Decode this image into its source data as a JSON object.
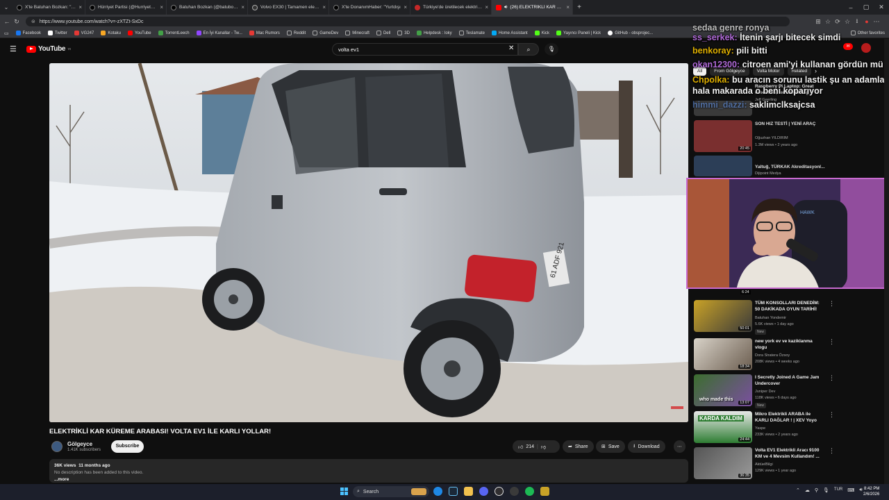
{
  "browser": {
    "tabs": [
      {
        "label": "X'te Batuhan Bozkan: \"Paypal, Ap",
        "color": "#000000"
      },
      {
        "label": "Hürriyet Partisi (@HurriyetPartiIl)",
        "color": "#000000"
      },
      {
        "label": "Batuhan Bozkan (@batubozkan) /",
        "color": "#000000"
      },
      {
        "label": "Volvo EX30 | Tamamen elektrikli k",
        "color": "#222222"
      },
      {
        "label": "X'te DonanımHaber: \"Yurtdışı",
        "color": "#000000"
      },
      {
        "label": "Türkiye'de üretilecek elektrikli Hy",
        "color": "#c62828"
      },
      {
        "label": "(26) ELEKTRİKLİ KAR KÜREM",
        "color": "#ff0000",
        "active": true
      }
    ],
    "url": "https://www.youtube.com/watch?v=-zXTZt-SxDc",
    "bookmarks": [
      {
        "label": "Facebook",
        "color": "#1877f2"
      },
      {
        "label": "Twitter",
        "color": "#ffffff"
      },
      {
        "label": "VG247",
        "color": "#e53935"
      },
      {
        "label": "Kotaku",
        "color": "#f9a825"
      },
      {
        "label": "YouTube",
        "color": "#ff0000"
      },
      {
        "label": "TorrentLeech",
        "color": "#43a047"
      },
      {
        "label": "En İyi Kanallar - Tw...",
        "color": "#9146ff"
      },
      {
        "label": "Mac Rumors",
        "color": "#e53935"
      },
      {
        "label": "Reddit",
        "color": "#aaaaaa"
      },
      {
        "label": "GameDev",
        "color": "#aaaaaa"
      },
      {
        "label": "Minecraft",
        "color": "#aaaaaa"
      },
      {
        "label": "Dell",
        "color": "#aaaaaa"
      },
      {
        "label": "3D",
        "color": "#aaaaaa"
      },
      {
        "label": "Helpdesk : loky",
        "color": "#43a047"
      },
      {
        "label": "Teslamate",
        "color": "#aaaaaa"
      },
      {
        "label": "Home Assistant",
        "color": "#03a9f4"
      },
      {
        "label": "Kick",
        "color": "#53fc18"
      },
      {
        "label": "Yayıncı Paneli | Kick",
        "color": "#53fc18"
      },
      {
        "label": "GitHub - obsprojec...",
        "color": "#ffffff"
      },
      {
        "label": "Other favorites",
        "color": "#aaaaaa"
      }
    ]
  },
  "youtube": {
    "logo": "YouTube",
    "country": "TR",
    "search_value": "volta ev1",
    "video": {
      "title": "ELEKTRİKLİ KAR KÜREME ARABASI! VOLTA EV1 İLE KARLI YOLLAR!",
      "channel": "Gölgeyce",
      "subscribers": "1.41K subscribers",
      "subscribe_label": "Subscribe",
      "likes": "214",
      "share_label": "Share",
      "save_label": "Save",
      "download_label": "Download",
      "views": "36K views",
      "age": "11 months ago",
      "description": "No description has been added to this video.",
      "more_label": "...more",
      "plate": "61 ADF 921"
    },
    "chips": [
      "All",
      "From Gölgeyce",
      "Volta Motor",
      "Related"
    ],
    "recommendations_top": [
      {
        "title": "Raspberry Pi Laptop: Great execution, terrible timing",
        "channel": "Jeff Geerling"
      },
      {
        "title": "SON HIZ TESTİ | YENİ ARAÇ",
        "channel": "Oğuzhan YILDIRIM",
        "meta": "1.3M views • 2 years ago",
        "duration": "20:45"
      },
      {
        "title": "Yaltuğ, TÜRKAK Akreditasyonl...",
        "channel": "Dijipoint Medya"
      }
    ],
    "recommendations": [
      {
        "title": "TÜM KONSOLLARI DENEDİM: 50 DAKİKADA OYUN TARİHİ!",
        "channel": "Batuhan Yondemir",
        "meta": "5.6K views • 1 day ago",
        "badge": "New",
        "duration": "50:01",
        "color1": "#c9a227",
        "color2": "#3a3a3a"
      },
      {
        "title": "new york ev ve kaziklanma vlogu",
        "channel": "Dora Stratera Özsoy",
        "meta": "208K views • 4 weeks ago",
        "duration": "18:34",
        "color1": "#d8d2c8",
        "color2": "#6b5d4f"
      },
      {
        "title": "I Secretly Joined A Game Jam Undercover",
        "channel": "Juniper Dev",
        "meta": "118K views • 6 days ago",
        "badge": "New",
        "duration": "13:07",
        "overlay": "who made this",
        "color1": "#3b6e2e",
        "color2": "#7b4fa0"
      },
      {
        "title": "Mikro Elektrikli ARABA ile KARLI DAĞLAR ! | XEV Yoyo",
        "channel": "Yaspe",
        "meta": "233K views • 2 years ago",
        "duration": "24:44",
        "overlay": "KARDA KALDIM",
        "color1": "#e8e8e8",
        "color2": "#2e7d32"
      },
      {
        "title": "Volta EV1 Elektrikli Aracı 9100 KM ve 4 Mevsim Kullandım! ...",
        "channel": "AktüelBilgi",
        "meta": "129K views • 1 year ago",
        "duration": "36:35",
        "color1": "#555555",
        "color2": "#999999"
      }
    ]
  },
  "chat": [
    {
      "user": "sedaa genre ronya",
      "text": "",
      "color": "#bdbdbd"
    },
    {
      "user": "ss_serkek:",
      "text": "İtenin şarjı bitecek simdi",
      "color": "#b06ad8"
    },
    {
      "user": "benkoray:",
      "text": "pili bitti",
      "color": "#e0b000"
    },
    {
      "user": "okan12300:",
      "text": "citroen ami'yi kullanan gördün mü",
      "color": "#b06ad8"
    },
    {
      "user": "Chpolka:",
      "text": "bu aracın sorunu lastik şu an adamlar hala makarada o beni koparıyor",
      "color": "#e0b000"
    },
    {
      "user": "himmi_dazzi:",
      "text": "saklimclksajcsa",
      "color": "#5e8ee0"
    }
  ],
  "webcam_text": "HAWK",
  "taskbar": {
    "search_label": "Search",
    "lang": "TUR",
    "time": "8:42 PM",
    "date": "2/6/2026"
  },
  "colors": {
    "accent": "#ff0000",
    "chat_user_purple": "#b06ad8",
    "chat_user_gold": "#e0b000",
    "webcam_border": "#c86ad0"
  }
}
